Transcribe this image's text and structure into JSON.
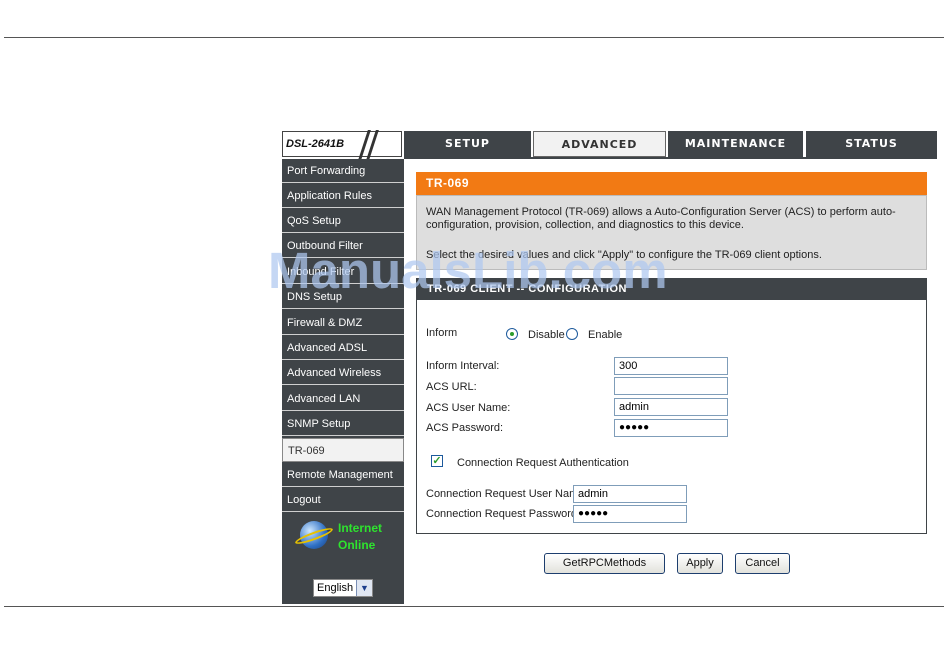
{
  "brand": {
    "model": "DSL-2641B"
  },
  "top_nav": [
    {
      "label": "SETUP"
    },
    {
      "label": "ADVANCED",
      "active": true
    },
    {
      "label": "MAINTENANCE"
    },
    {
      "label": "STATUS"
    }
  ],
  "sidebar": {
    "items": [
      {
        "label": "Port Forwarding"
      },
      {
        "label": "Application Rules"
      },
      {
        "label": "QoS Setup"
      },
      {
        "label": "Outbound Filter"
      },
      {
        "label": "Inbound Filter"
      },
      {
        "label": "DNS Setup"
      },
      {
        "label": "Firewall & DMZ"
      },
      {
        "label": "Advanced ADSL"
      },
      {
        "label": "Advanced Wireless"
      },
      {
        "label": "Advanced LAN"
      },
      {
        "label": "SNMP Setup"
      },
      {
        "label": "TR-069",
        "active": true
      },
      {
        "label": "Remote Management"
      },
      {
        "label": "Logout"
      }
    ],
    "status_line1": "Internet",
    "status_line2": "Online",
    "language": "English"
  },
  "section": {
    "title": "TR-069",
    "desc1": "WAN Management Protocol (TR-069) allows a Auto-Configuration Server (ACS) to perform auto-configuration, provision, collection, and diagnostics to this device.",
    "desc2": "Select the desired values and click \"Apply\" to configure the TR-069 client options."
  },
  "form": {
    "title": "TR-069 CLIENT -- CONFIGURATION",
    "inform_label": "Inform",
    "disable_label": "Disable",
    "enable_label": "Enable",
    "inform_value": "Disable",
    "interval_label": "Inform Interval:",
    "interval_value": "300",
    "acs_url_label": "ACS URL:",
    "acs_url_value": "",
    "acs_user_label": "ACS User Name:",
    "acs_user_value": "admin",
    "acs_pass_label": "ACS Password:",
    "acs_pass_value": "●●●●●",
    "conn_auth_label": "Connection Request Authentication",
    "conn_auth_checked": true,
    "conn_user_label": "Connection Request User Name:",
    "conn_user_value": "admin",
    "conn_pass_label": "Connection Request Password:",
    "conn_pass_value": "●●●●●"
  },
  "buttons": {
    "getrpc": "GetRPCMethods",
    "apply": "Apply",
    "cancel": "Cancel"
  },
  "watermark": "ManualsLib.com",
  "colors": {
    "accent": "#f27a14",
    "nav_dark": "#3f4448",
    "online_green": "#2ee32e"
  }
}
